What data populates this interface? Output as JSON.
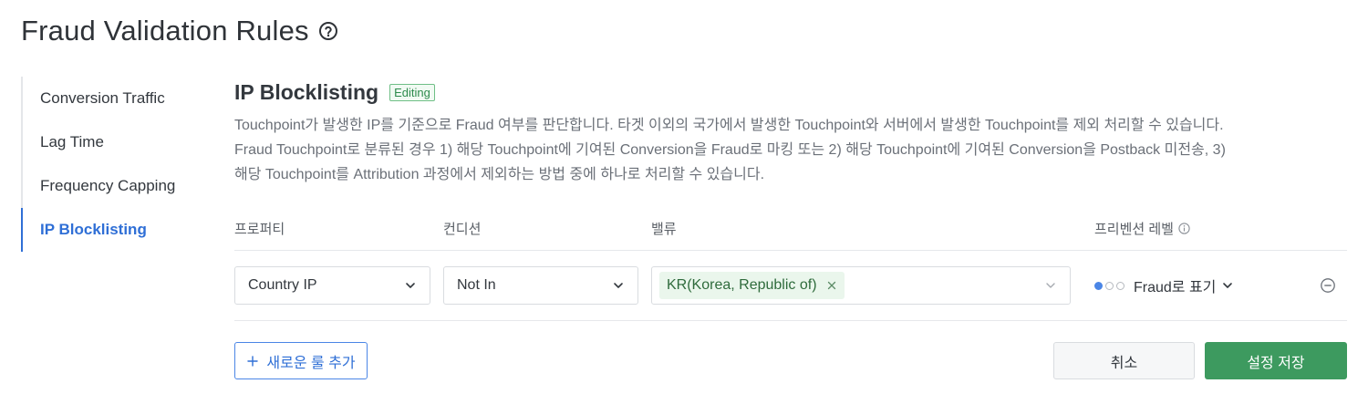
{
  "page": {
    "title": "Fraud Validation Rules",
    "help_icon": "question-circle-icon"
  },
  "sidebar": {
    "items": [
      {
        "label": "Conversion Traffic",
        "active": false
      },
      {
        "label": "Lag Time",
        "active": false
      },
      {
        "label": "Frequency Capping",
        "active": false
      },
      {
        "label": "IP Blocklisting",
        "active": true
      }
    ]
  },
  "section": {
    "title": "IP Blocklisting",
    "badge": "Editing",
    "description": "Touchpoint가 발생한 IP를 기준으로 Fraud 여부를 판단합니다. 타겟 이외의 국가에서 발생한 Touchpoint와 서버에서 발생한 Touchpoint를 제외 처리할 수 있습니다. Fraud Touchpoint로 분류된 경우 1) 해당 Touchpoint에 기여된 Conversion을 Fraud로 마킹 또는 2) 해당 Touchpoint에 기여된 Conversion을 Postback 미전송, 3) 해당 Touchpoint를 Attribution 과정에서 제외하는 방법 중에 하나로 처리할 수 있습니다."
  },
  "table": {
    "headers": {
      "property": "프로퍼티",
      "condition": "컨디션",
      "value": "밸류",
      "prevention_level": "프리벤션 레벨"
    },
    "rows": [
      {
        "property": "Country IP",
        "condition": "Not In",
        "values": [
          "KR(Korea, Republic of)"
        ],
        "prevention_level": "Fraud로 표기",
        "level_dots": 1,
        "level_dots_total": 3
      }
    ]
  },
  "actions": {
    "add_rule": "새로운 룰 추가",
    "cancel": "취소",
    "save": "설정 저장"
  },
  "colors": {
    "accent": "#2f6fd6",
    "save": "#3d9a5f",
    "badge": "#2e8b4d",
    "tag_bg": "#eaf6ec"
  }
}
